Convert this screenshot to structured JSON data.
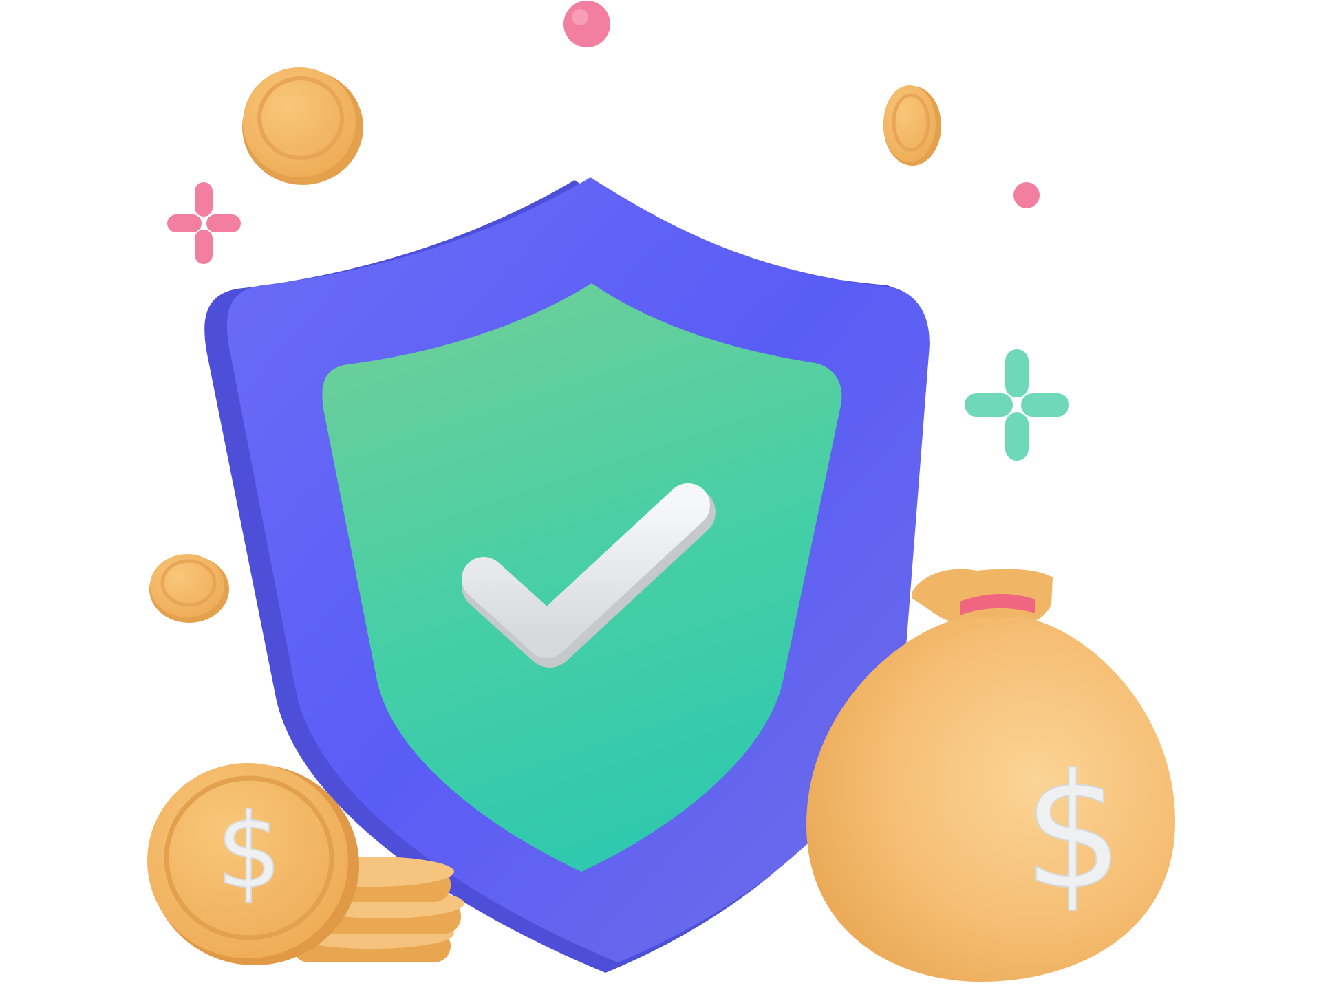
{
  "illustration": {
    "subject": "shield-with-checkmark-and-money",
    "colors": {
      "shield_outer": "#5b5cf0",
      "shield_inner": "#3ecfae",
      "check": "#e9ecee",
      "coin": "#f2b865",
      "bag": "#f5bd72",
      "sparkle_pink": "#f37fa0",
      "sparkle_mint": "#6fd8b8"
    },
    "icons": [
      "shield-icon",
      "checkmark-icon",
      "coin-icon",
      "money-bag-icon",
      "sparkle-icon",
      "dot-icon"
    ],
    "coin_symbol": "$",
    "bag_symbol": "$"
  }
}
